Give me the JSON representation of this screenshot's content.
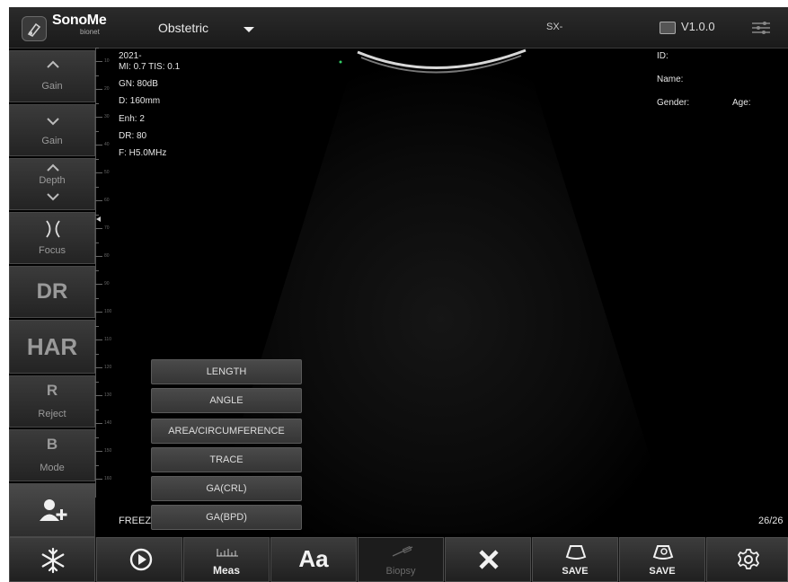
{
  "header": {
    "brand": "SonoMe",
    "brand_sub": "bionet",
    "exam": "Obstetric",
    "probe": "SX-",
    "version": "V1.0.0"
  },
  "left_controls": [
    {
      "label": "Gain",
      "icon": "chevron-up-icon"
    },
    {
      "label": "Gain",
      "icon": "chevron-down-icon"
    },
    {
      "label": "Depth",
      "icon": "up-down-chevron-icon"
    },
    {
      "label": "Focus",
      "icon": "focus-icon"
    },
    {
      "label": "DR"
    },
    {
      "label": "HAR"
    },
    {
      "big": "R",
      "label": "Reject"
    },
    {
      "big": "B",
      "label": "Mode"
    },
    {
      "icon": "add-patient-icon"
    }
  ],
  "image_info": {
    "date": "2021-",
    "mi_tis": "MI: 0.7  TIS: 0.1",
    "gain": "GN: 80dB",
    "depth": "D: 160mm",
    "enh": "Enh: 2",
    "dr": "DR: 80",
    "freq": "F: H5.0MHz"
  },
  "patient": {
    "id_label": "ID:",
    "name_label": "Name:",
    "gender_label": "Gender:",
    "age_label": "Age:"
  },
  "scale_labels": [
    "10",
    "20",
    "30",
    "40",
    "50",
    "60",
    "70",
    "80",
    "90",
    "100",
    "110",
    "120",
    "130",
    "140",
    "150",
    "160"
  ],
  "measure_menu": [
    "LENGTH",
    "ANGLE",
    "AREA/CIRCUMFERENCE",
    "TRACE",
    "GA(CRL)",
    "GA(BPD)"
  ],
  "status": {
    "freeze": "FREEZ",
    "frame": "26/26"
  },
  "bottom_toolbar": [
    {
      "icon": "freeze-snowflake-icon",
      "label": ""
    },
    {
      "icon": "play-icon",
      "label": ""
    },
    {
      "icon": "ruler-icon",
      "label": "Meas"
    },
    {
      "icon": "",
      "label": "Aa"
    },
    {
      "icon": "biopsy-needle-icon",
      "label": "Biopsy"
    },
    {
      "icon": "close-icon",
      "label": ""
    },
    {
      "icon": "save-image-icon",
      "label": "SAVE"
    },
    {
      "icon": "save-cine-icon",
      "label": "SAVE"
    },
    {
      "icon": "gear-icon",
      "label": ""
    }
  ]
}
